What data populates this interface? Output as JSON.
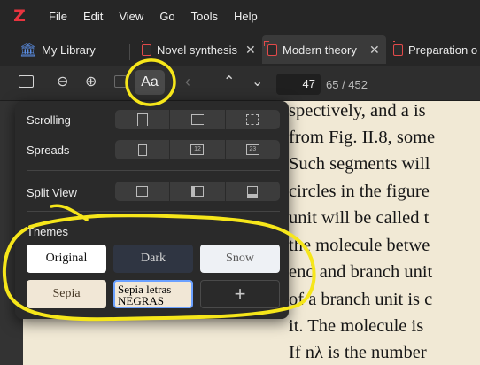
{
  "app": {
    "logo": "Z"
  },
  "menu": [
    "File",
    "Edit",
    "View",
    "Go",
    "Tools",
    "Help"
  ],
  "tabs": [
    {
      "label": "My Library",
      "icon": "library-icon"
    },
    {
      "label": "Novel synthesis",
      "icon": "pdf-icon"
    },
    {
      "label": "Modern theory",
      "icon": "pdf-icon",
      "active": true
    },
    {
      "label": "Preparation o",
      "icon": "pdf-icon"
    }
  ],
  "toolbar": {
    "font_button": "Aa",
    "page_input": "47",
    "page_total": "65 / 452"
  },
  "popup": {
    "scrolling_label": "Scrolling",
    "spreads_label": "Spreads",
    "split_view_label": "Split View",
    "themes_label": "Themes",
    "themes": [
      {
        "label": "Original",
        "bg": "#ffffff",
        "fg": "#111111"
      },
      {
        "label": "Dark",
        "bg": "#2f3542",
        "fg": "#d8d8d8"
      },
      {
        "label": "Snow",
        "bg": "#eef1f5",
        "fg": "#555555"
      },
      {
        "label": "Sepia",
        "bg": "#f1e7d6",
        "fg": "#4a3b28"
      },
      {
        "label": "Sepia letras NEGRAS",
        "bg": "#f1e7d6",
        "fg": "#000000"
      },
      {
        "label": "+",
        "bg": "#2a2a2a",
        "fg": "#c8c8c8"
      }
    ]
  },
  "document": {
    "lines": [
      "spectively, and a is",
      "from Fig. II.8, some",
      "Such segments will",
      "circles in the figure",
      "unit will be called t",
      "the molecule betwe",
      "end and branch unit",
      "of a branch unit is c",
      "it.  The molecule is",
      "If nλ is the number"
    ]
  },
  "colors": {
    "highlight": "#f6e61a",
    "logo": "#e8343f",
    "pdf_icon": "#e24a4a"
  }
}
